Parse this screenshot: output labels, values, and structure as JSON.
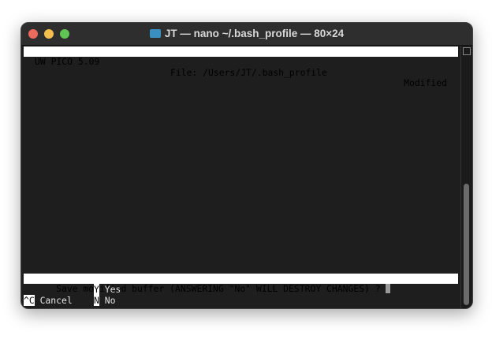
{
  "window": {
    "title": "JT — nano ~/.bash_profile — 80×24"
  },
  "header": {
    "app": "UW PICO 5.09",
    "file": "File: /Users/JT/.bash_profile",
    "status": "Modified"
  },
  "prompt": {
    "text": "Save modified buffer (ANSWERING \"No\" WILL DESTROY CHANGES) ? "
  },
  "options": [
    {
      "key": "Y",
      "label": "Yes"
    },
    {
      "key": "N",
      "label": "No"
    }
  ],
  "shortcuts": [
    {
      "key": "^C",
      "label": "Cancel"
    }
  ],
  "colors": {
    "close": "#ed6a5e",
    "minimize": "#f5bf4f",
    "zoom": "#61c554"
  }
}
